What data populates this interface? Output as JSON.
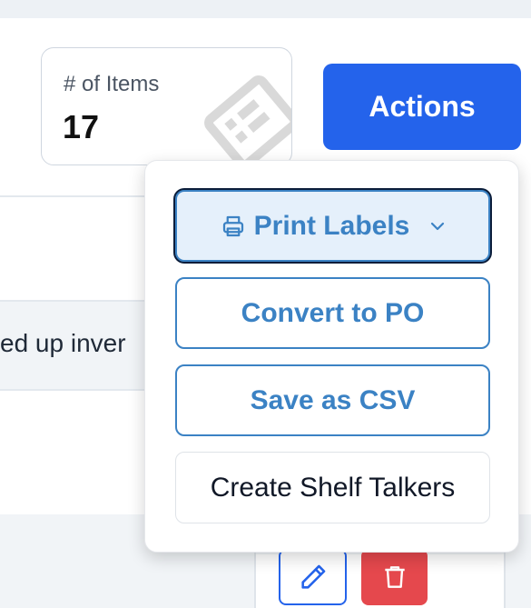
{
  "summary": {
    "items_label": "# of Items",
    "items_value": "17"
  },
  "actions": {
    "label": "Actions",
    "menu": [
      {
        "label": "Print Labels",
        "icon": "printer-icon",
        "has_submenu": true
      },
      {
        "label": "Convert to PO"
      },
      {
        "label": "Save as CSV"
      },
      {
        "label": "Create Shelf Talkers"
      }
    ]
  },
  "table": {
    "partial_cell_text": "ed up inver"
  },
  "row_actions": {
    "edit_icon": "pencil-icon",
    "delete_icon": "trash-icon"
  },
  "colors": {
    "accent": "#2463eb",
    "menu_text": "#3b82c4",
    "delete": "#e5484d",
    "active_bg": "#e5f0fb"
  }
}
